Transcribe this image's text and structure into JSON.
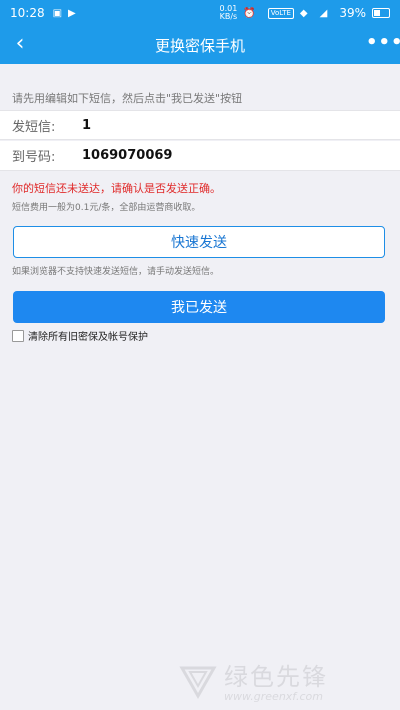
{
  "status_bar": {
    "time": "10:28",
    "speed_value": "0.01",
    "speed_unit": "KB/s",
    "battery": "39%",
    "network_badge": "VoLTE"
  },
  "nav": {
    "title": "更换密保手机"
  },
  "instruction": "请先用编辑如下短信，然后点击\"我已发送\"按钮",
  "sms": {
    "content_label": "发短信:",
    "content_value": "1",
    "number_label": "到号码:",
    "number_value": "1069070069"
  },
  "warning": "你的短信还未送达，请确认是否发送正确。",
  "fee_note": "短信费用一般为0.1元/条，全部由运营商收取。",
  "buttons": {
    "quick_send": "快速发送",
    "sent": "我已发送"
  },
  "manual_hint": "如果浏览器不支持快速发送短信，请手动发送短信。",
  "checkbox": {
    "label": "清除所有旧密保及帐号保护",
    "checked": false
  },
  "watermark": {
    "text": "绿色先锋",
    "url": "www.greenxf.com"
  },
  "colors": {
    "header": "#1e9bea",
    "primary_button": "#1e88f0",
    "warning": "#e02a2a"
  }
}
